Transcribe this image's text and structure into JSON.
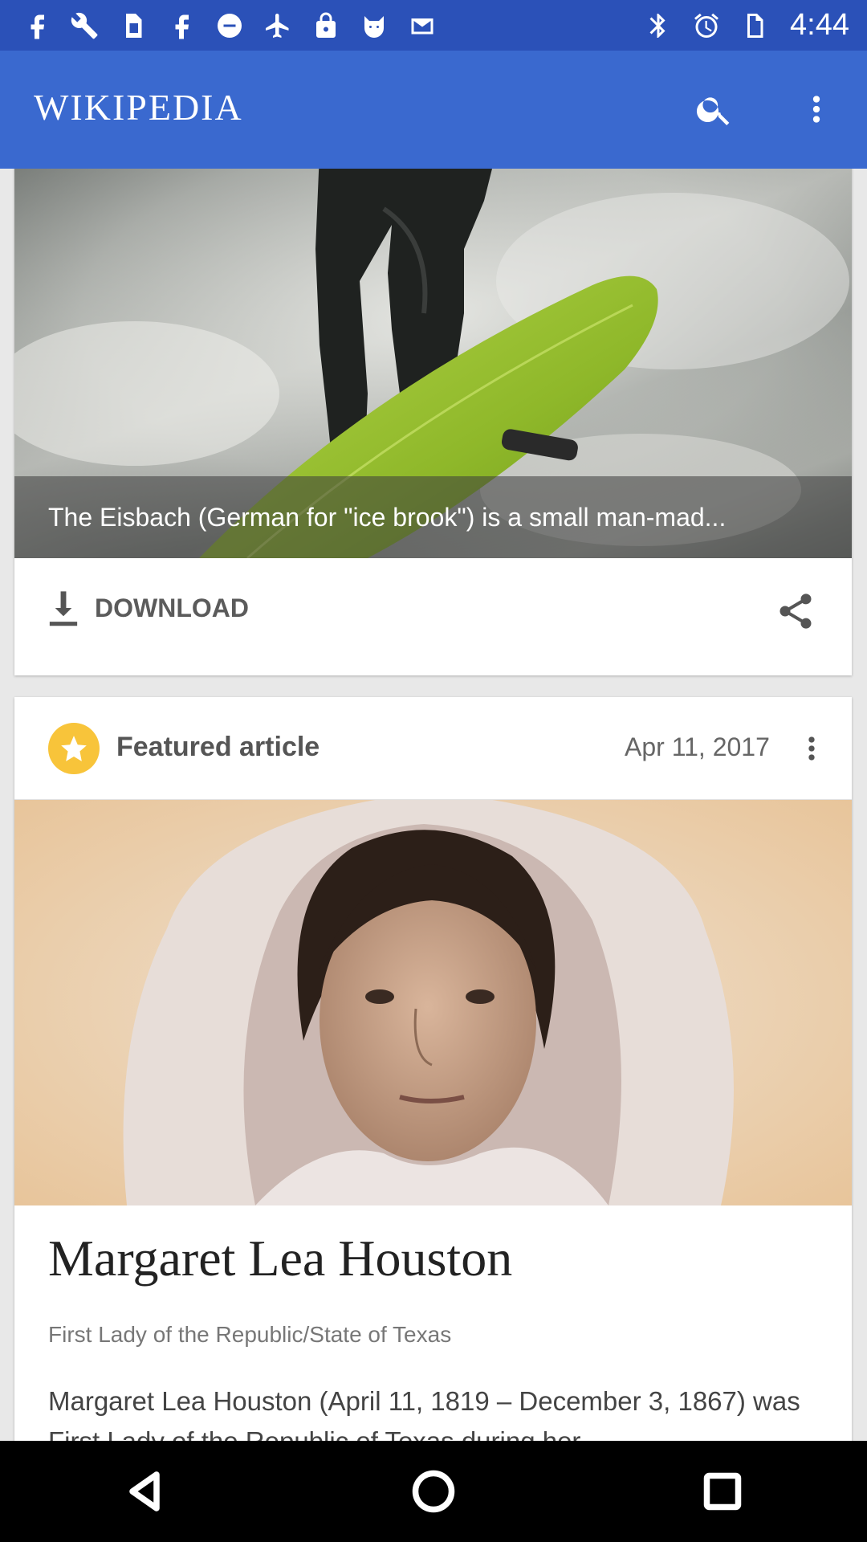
{
  "status_bar": {
    "time": "4:44",
    "left_icons": [
      "facebook-icon",
      "wrench-icon",
      "sim-card-icon",
      "facebook-icon",
      "no-entry-icon",
      "airplane-icon",
      "lock-icon",
      "cat-icon",
      "mail-check-icon"
    ],
    "right_icons": [
      "bluetooth-icon",
      "alarm-icon",
      "no-sim-icon"
    ]
  },
  "app_bar": {
    "title": "WIKIPEDIA",
    "search_icon": "search-icon",
    "overflow_icon": "more-vert-icon",
    "color": "#3a69cf"
  },
  "picture_card": {
    "caption": "The Eisbach (German for \"ice brook\") is a small man-mad...",
    "download_label": "DOWNLOAD",
    "download_icon": "download-icon",
    "share_icon": "share-icon"
  },
  "featured_card": {
    "label": "Featured article",
    "date": "Apr 11, 2017",
    "badge_icon": "star-icon",
    "menu_icon": "more-vert-icon",
    "title": "Margaret Lea Houston",
    "subtitle": "First Lady of the Republic/State of Texas",
    "extract": "Margaret Lea Houston (April 11, 1819 – December 3, 1867) was First Lady of the Republic of Texas during her"
  },
  "nav_bar": {
    "buttons": [
      "back-icon",
      "home-icon",
      "recents-icon"
    ]
  }
}
